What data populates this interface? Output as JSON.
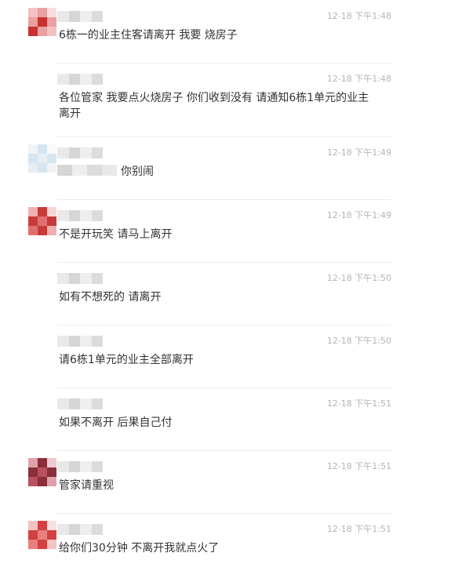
{
  "messages": [
    {
      "time": "12-18 下午1:48",
      "text": "6栋一的业主住客请离开 我要 烧房子",
      "avatar_colors": [
        "#e8a0a0",
        "#c93030",
        "#f2c2c2"
      ]
    },
    {
      "time": "12-18 下午1:48",
      "text": "各位管家 我要点火烧房子 你们收到没有 请通知6栋1单元的业主离开",
      "avatar_colors": []
    },
    {
      "time": "12-18 下午1:49",
      "text": "你别闹",
      "avatar_colors": [
        "#d6e6f0",
        "#e7eef4",
        "#f1f4f7"
      ]
    },
    {
      "time": "12-18 下午1:49",
      "text": "不是开玩笑 请马上离开",
      "avatar_colors": [
        "#c83a3a",
        "#e07070",
        "#f0b0b0"
      ]
    },
    {
      "time": "12-18 下午1:50",
      "text": "如有不想死的 请离开",
      "avatar_colors": []
    },
    {
      "time": "12-18 下午1:50",
      "text": "请6栋1单元的业主全部离开",
      "avatar_colors": []
    },
    {
      "time": "12-18 下午1:51",
      "text": "如果不离开 后果自己付",
      "avatar_colors": []
    },
    {
      "time": "12-18 下午1:51",
      "text": "管家请重视",
      "avatar_colors": [
        "#8a2e3a",
        "#b85060",
        "#e0a0aa"
      ]
    },
    {
      "time": "12-18 下午1:51",
      "text": "给你们30分钟 不离开我就点火了",
      "avatar_colors": [
        "#d24040",
        "#e88080",
        "#f4c4c4"
      ]
    }
  ]
}
